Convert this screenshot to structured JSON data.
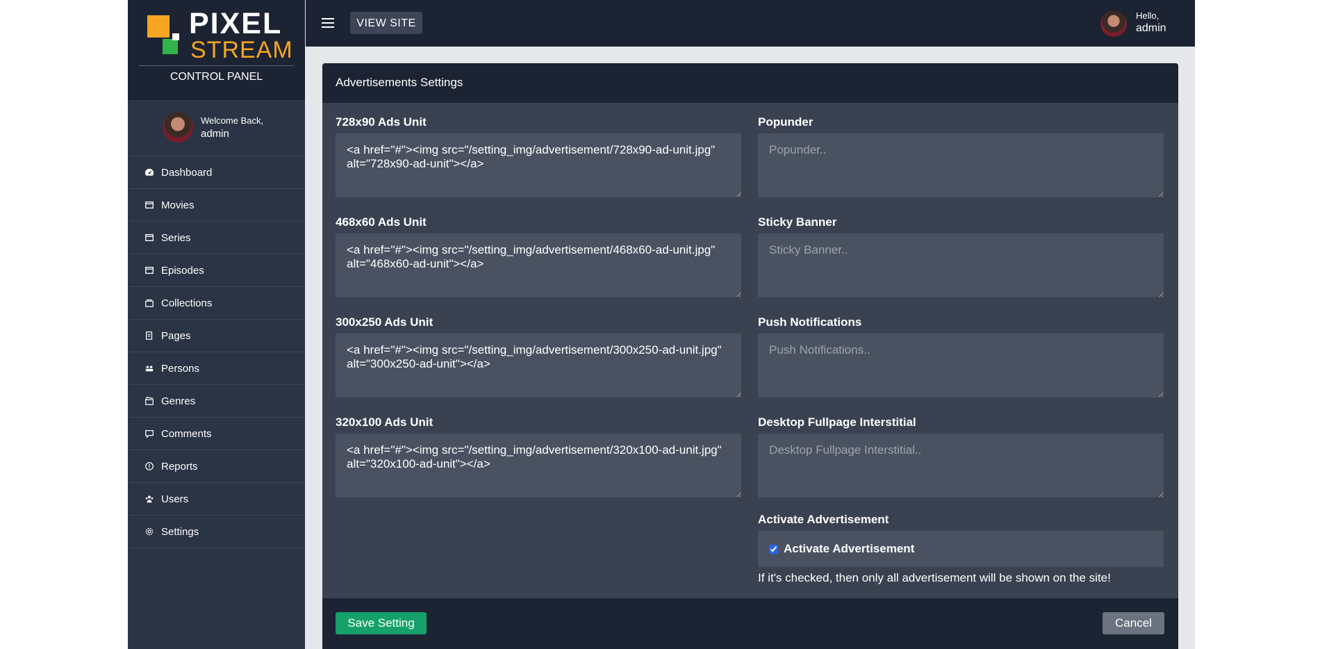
{
  "brand": {
    "pixel": "PIXEL",
    "stream": "STREAM",
    "panel_label": "CONTROL PANEL"
  },
  "sidebar": {
    "welcome": "Welcome Back,",
    "username": "admin",
    "items": [
      {
        "label": "Dashboard",
        "icon": "dashboard-icon"
      },
      {
        "label": "Movies",
        "icon": "film-icon"
      },
      {
        "label": "Series",
        "icon": "film-icon"
      },
      {
        "label": "Episodes",
        "icon": "film-icon"
      },
      {
        "label": "Collections",
        "icon": "collection-icon"
      },
      {
        "label": "Pages",
        "icon": "pages-icon"
      },
      {
        "label": "Persons",
        "icon": "persons-icon"
      },
      {
        "label": "Genres",
        "icon": "genre-icon"
      },
      {
        "label": "Comments",
        "icon": "comment-icon"
      },
      {
        "label": "Reports",
        "icon": "report-icon"
      },
      {
        "label": "Users",
        "icon": "users-icon"
      },
      {
        "label": "Settings",
        "icon": "gear-icon"
      }
    ]
  },
  "topbar": {
    "view_site": "VIEW SITE",
    "hello": "Hello,",
    "username": "admin"
  },
  "card": {
    "title": "Advertisements Settings",
    "left": [
      {
        "label": "728x90 Ads Unit",
        "value": "<a href=\"#\"><img src=\"/setting_img/advertisement/728x90-ad-unit.jpg\" alt=\"728x90-ad-unit\"></a>"
      },
      {
        "label": "468x60 Ads Unit",
        "value": "<a href=\"#\"><img src=\"/setting_img/advertisement/468x60-ad-unit.jpg\" alt=\"468x60-ad-unit\"></a>"
      },
      {
        "label": "300x250 Ads Unit",
        "value": "<a href=\"#\"><img src=\"/setting_img/advertisement/300x250-ad-unit.jpg\" alt=\"300x250-ad-unit\"></a>"
      },
      {
        "label": "320x100 Ads Unit",
        "value": "<a href=\"#\"><img src=\"/setting_img/advertisement/320x100-ad-unit.jpg\" alt=\"320x100-ad-unit\"></a>"
      }
    ],
    "right": [
      {
        "label": "Popunder",
        "placeholder": "Popunder.."
      },
      {
        "label": "Sticky Banner",
        "placeholder": "Sticky Banner.."
      },
      {
        "label": "Push Notifications",
        "placeholder": "Push Notifications.."
      },
      {
        "label": "Desktop Fullpage Interstitial",
        "placeholder": "Desktop Fullpage Interstitial.."
      }
    ],
    "activate": {
      "label": "Activate Advertisement",
      "checkbox_label": "Activate Advertisement",
      "checked": true,
      "help": "If it's checked, then only all advertisement will be shown on the site!"
    },
    "save_label": "Save Setting",
    "cancel_label": "Cancel"
  }
}
